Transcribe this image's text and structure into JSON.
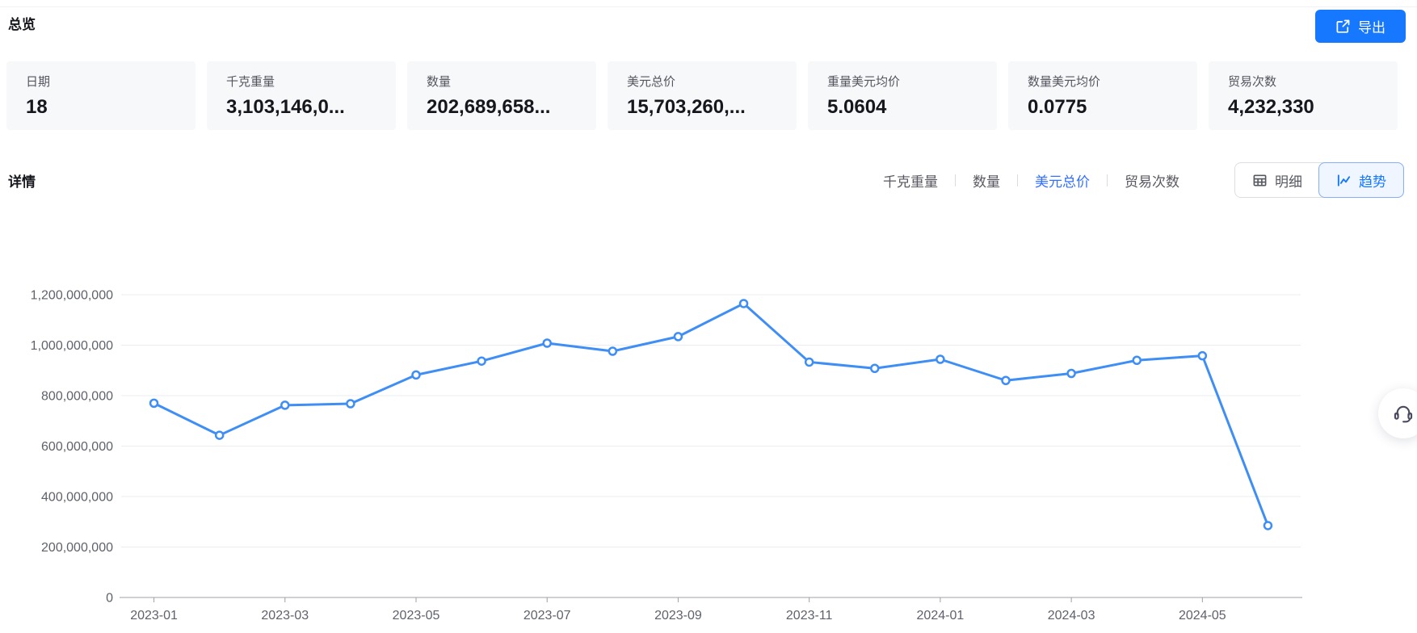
{
  "page": {
    "title": "总览",
    "detail_title": "详情"
  },
  "export_button": {
    "label": "导出",
    "icon": "export-icon"
  },
  "stat_cards": [
    {
      "label": "日期",
      "value": "18"
    },
    {
      "label": "千克重量",
      "value": "3,103,146,0..."
    },
    {
      "label": "数量",
      "value": "202,689,658..."
    },
    {
      "label": "美元总价",
      "value": "15,703,260,..."
    },
    {
      "label": "重量美元均价",
      "value": "5.0604"
    },
    {
      "label": "数量美元均价",
      "value": "0.0775"
    },
    {
      "label": "贸易次数",
      "value": "4,232,330"
    }
  ],
  "metric_tabs": [
    {
      "label": "千克重量",
      "active": false
    },
    {
      "label": "数量",
      "active": false
    },
    {
      "label": "美元总价",
      "active": true
    },
    {
      "label": "贸易次数",
      "active": false
    }
  ],
  "view_toggle": [
    {
      "label": "明细",
      "icon": "table-icon",
      "active": false
    },
    {
      "label": "趋势",
      "icon": "trend-icon",
      "active": true
    }
  ],
  "floating_button": {
    "icon": "headset-icon"
  },
  "colors": {
    "accent": "#1677ff",
    "tab_active": "#3370ff",
    "line": "#3e8ef5",
    "grid": "#eaecf2",
    "axis": "#9da0a8",
    "tick_label": "#5f626b"
  },
  "chart_data": {
    "type": "line",
    "title": "",
    "xlabel": "",
    "ylabel": "",
    "x": [
      "2023-01",
      "2023-02",
      "2023-03",
      "2023-04",
      "2023-05",
      "2023-06",
      "2023-07",
      "2023-08",
      "2023-09",
      "2023-10",
      "2023-11",
      "2023-12",
      "2024-01",
      "2024-02",
      "2024-03",
      "2024-04",
      "2024-05",
      "2024-06"
    ],
    "values": [
      770000000,
      643000000,
      762000000,
      768000000,
      882000000,
      937000000,
      1008000000,
      976000000,
      1034000000,
      1165000000,
      933000000,
      908000000,
      944000000,
      860000000,
      888000000,
      940000000,
      958000000,
      285000000
    ],
    "series_name": "美元总价",
    "ylim": [
      0,
      1200000000
    ],
    "y_tick_step": 200000000,
    "y_tick_labels": [
      "0",
      "200,000,000",
      "400,000,000",
      "600,000,000",
      "800,000,000",
      "1,000,000,000",
      "1,200,000,000"
    ],
    "x_tick_labels": [
      "2023-01",
      "2023-03",
      "2023-05",
      "2023-07",
      "2023-09",
      "2023-11",
      "2024-01",
      "2024-03",
      "2024-05"
    ],
    "x_label_every": 2,
    "grid": true,
    "legend_position": "none",
    "marker": "hollow-circle"
  }
}
